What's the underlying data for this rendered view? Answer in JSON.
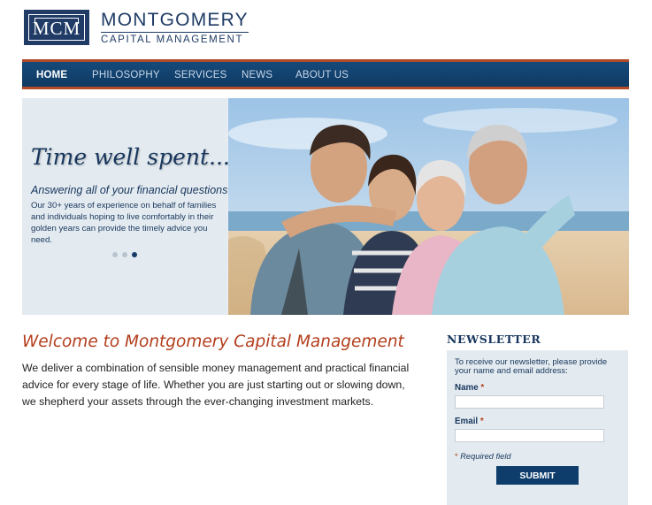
{
  "brand": {
    "mark": "MCM",
    "title": "MONTGOMERY",
    "subtitle": "CAPITAL MANAGEMENT"
  },
  "nav": {
    "items": [
      {
        "label": "HOME",
        "active": true
      },
      {
        "label": "PHILOSOPHY",
        "active": false
      },
      {
        "label": "SERVICES",
        "active": false
      },
      {
        "label": "NEWS",
        "active": false
      },
      {
        "label": "ABOUT US",
        "active": false
      }
    ]
  },
  "hero": {
    "headline": "Time well spent...",
    "subheading": "Answering all of your financial questions",
    "body": "Our 30+ years of experience on behalf of families and individuals hoping to live comfortably in their golden years can provide the timely advice you need.",
    "slides_total": 3,
    "active_slide": 3
  },
  "main": {
    "welcome_title": "Welcome to Montgomery Capital Management",
    "intro": "We deliver a combination of sensible money management and practical financial advice for every stage of life. Whether you are just starting out or slowing down, we shepherd your assets through the ever-changing investment markets."
  },
  "newsletter": {
    "title": "NEWSLETTER",
    "intro": "To receive our newsletter, please provide your name and email address:",
    "name_label": "Name",
    "email_label": "Email",
    "required_marker": "*",
    "required_note": "Required field",
    "submit_label": "SUBMIT"
  },
  "colors": {
    "navy": "#17365d",
    "accent": "#b33e1d",
    "nav_bg": "#164a7a"
  }
}
